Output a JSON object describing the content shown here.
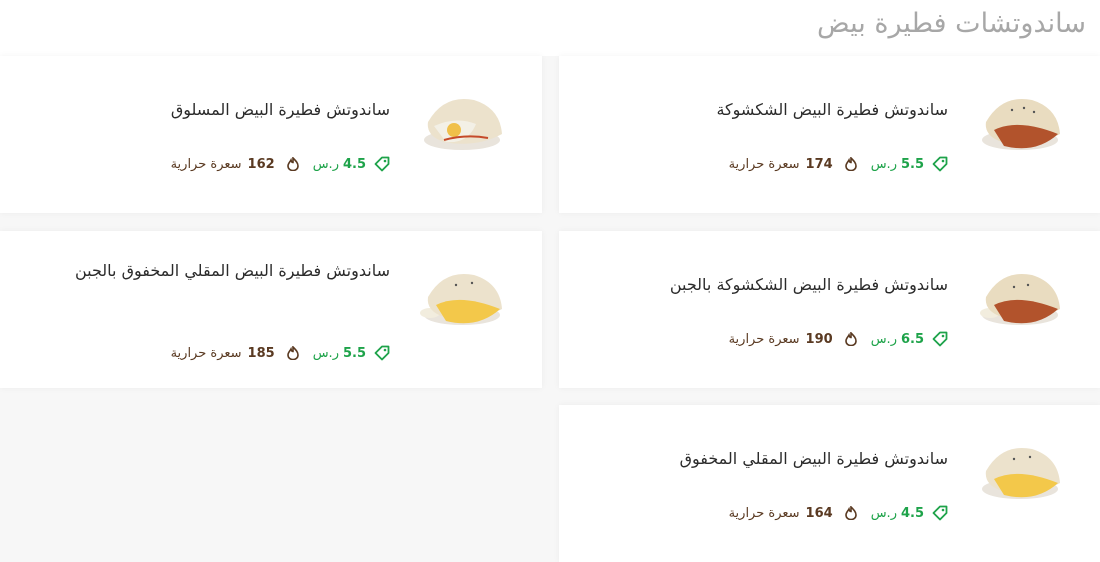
{
  "section": {
    "title": "ساندوتشات فطيرة بيض"
  },
  "items": [
    {
      "name": "ساندوتش فطيرة البيض الشكشوكة",
      "price": "5.5",
      "currency": "ر.س",
      "calories": "174",
      "calories_label": "سعرة حرارية",
      "image": "shakshuka-sandwich-image"
    },
    {
      "name": "ساندوتش فطيرة البيض المسلوق",
      "price": "4.5",
      "currency": "ر.س",
      "calories": "162",
      "calories_label": "سعرة حرارية",
      "image": "boiled-egg-sandwich-image"
    },
    {
      "name": "ساندوتش فطيرة البيض الشكشوكة بالجبن",
      "price": "6.5",
      "currency": "ر.س",
      "calories": "190",
      "calories_label": "سعرة حرارية",
      "image": "shakshuka-cheese-sandwich-image"
    },
    {
      "name": "ساندوتش فطيرة البيض المقلي المخفوق بالجبن",
      "price": "5.5",
      "currency": "ر.س",
      "calories": "185",
      "calories_label": "سعرة حرارية",
      "image": "scrambled-cheese-sandwich-image"
    },
    {
      "name": "ساندوتش فطيرة البيض المقلي المخفوق",
      "price": "4.5",
      "currency": "ر.س",
      "calories": "164",
      "calories_label": "سعرة حرارية",
      "image": "scrambled-egg-sandwich-image"
    }
  ],
  "colors": {
    "price": "#1ea34a",
    "calories": "#5a3a22",
    "title": "#a7a7a7"
  }
}
